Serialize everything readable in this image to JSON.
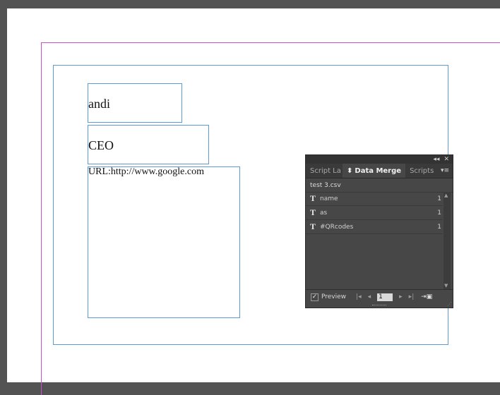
{
  "canvas": {
    "colors": {
      "pasteboard": "#535353",
      "page": "#ffffff",
      "margin_guide": "#c84fc8",
      "frame": "#5b9bd5"
    }
  },
  "text_frames": {
    "name": "andi",
    "title": "CEO",
    "url": "URL:http://www.google.com"
  },
  "panel": {
    "header_icons": [
      "collapse-icon",
      "close-icon"
    ],
    "tabs": [
      {
        "label": "Script La",
        "active": false
      },
      {
        "label": "Data Merge",
        "active": true
      },
      {
        "label": "Scripts",
        "active": false
      }
    ],
    "source_file": "test 3.csv",
    "fields": [
      {
        "type": "T",
        "name": "name",
        "count": "1"
      },
      {
        "type": "T",
        "name": "as",
        "count": "1"
      },
      {
        "type": "T",
        "name": "#QRcodes",
        "count": "1"
      }
    ],
    "preview_label": "Preview",
    "preview_checked": true,
    "record": "1"
  }
}
